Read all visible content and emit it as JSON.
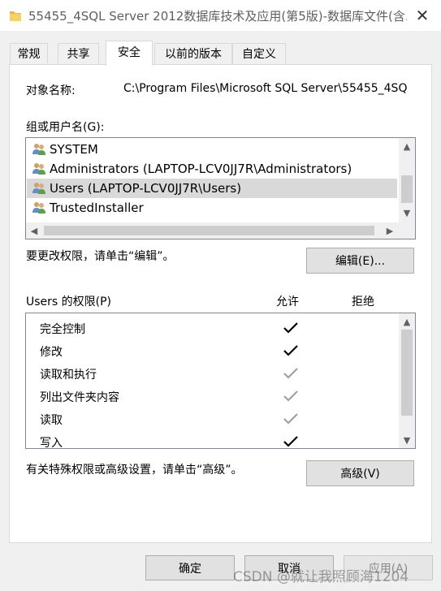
{
  "window": {
    "title": "55455_4SQL Server 2012数据库技术及应用(第5版)-数据库文件(含...",
    "close_glyph": "✕"
  },
  "tabs": [
    {
      "label": "常规",
      "active": false
    },
    {
      "label": "共享",
      "active": false
    },
    {
      "label": "安全",
      "active": true
    },
    {
      "label": "以前的版本",
      "active": false
    },
    {
      "label": "自定义",
      "active": false
    }
  ],
  "security": {
    "object_name_label": "对象名称:",
    "object_name_value": "C:\\Program Files\\Microsoft SQL Server\\55455_4SQ",
    "groups_label": "组或用户名(G):",
    "groups": [
      {
        "name": "SYSTEM",
        "icon": "user-group-icon",
        "selected": false
      },
      {
        "name": "Administrators (LAPTOP-LCV0JJ7R\\Administrators)",
        "icon": "user-group-icon",
        "selected": false
      },
      {
        "name": "Users (LAPTOP-LCV0JJ7R\\Users)",
        "icon": "user-group-icon",
        "selected": true
      },
      {
        "name": "TrustedInstaller",
        "icon": "user-group-icon",
        "selected": false
      }
    ],
    "change_hint": "要更改权限，请单击“编辑”。",
    "edit_button": "编辑(E)...",
    "perm_header": "Users 的权限(P)",
    "allow_header": "允许",
    "deny_header": "拒绝",
    "permissions": [
      {
        "name": "完全控制",
        "allow": "check-icon",
        "inherited": false
      },
      {
        "name": "修改",
        "allow": "check-icon",
        "inherited": false
      },
      {
        "name": "读取和执行",
        "allow": "check-icon",
        "inherited": true
      },
      {
        "name": "列出文件夹内容",
        "allow": "check-icon",
        "inherited": true
      },
      {
        "name": "读取",
        "allow": "check-icon",
        "inherited": true
      },
      {
        "name": "写入",
        "allow": "check-icon",
        "inherited": false
      }
    ],
    "advanced_hint": "有关特殊权限或高级设置，请单击“高级”。",
    "advanced_button": "高级(V)"
  },
  "footer": {
    "ok": "确定",
    "cancel": "取消",
    "apply": "应用(A)"
  },
  "watermark": "CSDN @就让我照顾海1204",
  "colors": {
    "selected_row": "#d9d9d9",
    "check_active": "#000000",
    "check_inherited": "#a0a0a0"
  }
}
